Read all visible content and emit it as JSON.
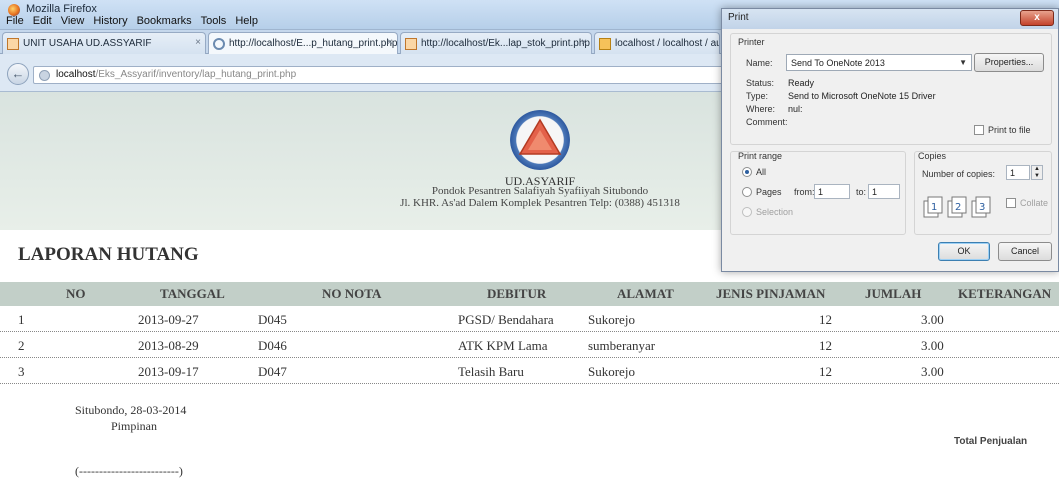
{
  "browser": {
    "window_title": "Mozilla Firefox",
    "menu": [
      "File",
      "Edit",
      "View",
      "History",
      "Bookmarks",
      "Tools",
      "Help"
    ],
    "tabs": [
      {
        "label": "UNIT USAHA UD.ASSYARIF",
        "active": false
      },
      {
        "label": "http://localhost/E...p_hutang_print.php",
        "active": true
      },
      {
        "label": "http://localhost/Ek...lap_stok_print.php",
        "active": false
      },
      {
        "label": "localhost / localhost / auni",
        "active": false
      }
    ],
    "url_host": "localhost",
    "url_path": "/Eks_Assyarif/inventory/lap_hutang_print.php"
  },
  "report": {
    "org_name": "UD.ASYARIF",
    "org_line1": "Pondok Pesantren Salafiyah Syafiiyah Situbondo",
    "org_line2": "Jl. KHR. As'ad Dalem Komplek Pesantren Telp: (0388) 451318",
    "title": "LAPORAN HUTANG",
    "columns": [
      "NO",
      "TANGGAL",
      "NO NOTA",
      "DEBITUR",
      "ALAMAT",
      "JENIS PINJAMAN",
      "JUMLAH",
      "KETERANGAN"
    ],
    "rows": [
      {
        "no": "1",
        "tanggal": "2013-09-27",
        "nota": "D045",
        "debitur": "PGSD/ Bendahara",
        "alamat": "Sukorejo",
        "jenis": "12",
        "jumlah": "3.00"
      },
      {
        "no": "2",
        "tanggal": "2013-08-29",
        "nota": "D046",
        "debitur": "ATK KPM Lama",
        "alamat": "sumberanyar",
        "jenis": "12",
        "jumlah": "3.00"
      },
      {
        "no": "3",
        "tanggal": "2013-09-17",
        "nota": "D047",
        "debitur": "Telasih Baru",
        "alamat": "Sukorejo",
        "jenis": "12",
        "jumlah": "3.00"
      }
    ],
    "place_date": "Situbondo, 28-03-2014",
    "position": "Pimpinan",
    "signature_line": "(-------------------------)",
    "total_label": "Total Penjualan"
  },
  "print_dialog": {
    "title": "Print",
    "close_label": "x",
    "printer_group": "Printer",
    "name_label": "Name:",
    "printer_name": "Send To OneNote 2013",
    "properties_label": "Properties...",
    "status_label": "Status:",
    "status_value": "Ready",
    "type_label": "Type:",
    "type_value": "Send to Microsoft OneNote 15 Driver",
    "where_label": "Where:",
    "where_value": "nul:",
    "comment_label": "Comment:",
    "print_to_file_label": "Print to file",
    "range_group": "Print range",
    "range_all": "All",
    "range_pages": "Pages",
    "from_label": "from:",
    "from_value": "1",
    "to_label": "to:",
    "to_value": "1",
    "range_selection": "Selection",
    "copies_group": "Copies",
    "copies_label": "Number of copies:",
    "copies_value": "1",
    "collate_label": "Collate",
    "ok_label": "OK",
    "cancel_label": "Cancel"
  }
}
